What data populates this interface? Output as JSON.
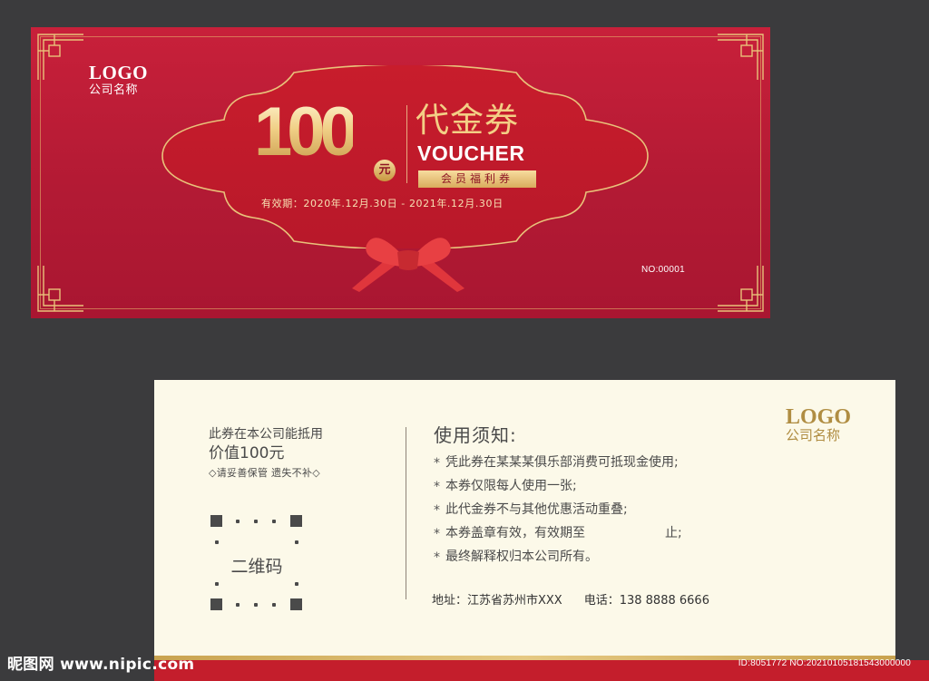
{
  "front": {
    "logo": "LOGO",
    "company": "公司名称",
    "amount": "100",
    "yuan": "元",
    "title_cn": "代金券",
    "title_en": "VOUCHER",
    "member_tag": "会员福利券",
    "validity": "有效期：2020年.12月.30日 - 2021年.12月.30日",
    "serial": "NO:00001"
  },
  "back": {
    "left": {
      "line1": "此券在本公司能抵用",
      "line2": "价值100元",
      "line3": "◇请妥善保管 遗失不补◇",
      "qr_label": "二维码"
    },
    "notice": {
      "title": "使用须知:",
      "items": [
        "凭此券在某某某俱乐部消费可抵现金使用;",
        "本券仅限每人使用一张;",
        "此代金券不与其他优惠活动重叠;"
      ],
      "item4_before": "本券盖章有效，有效期至",
      "item4_after": "止;",
      "item5": "最终解释权归本公司所有。"
    },
    "address": "地址：江苏省苏州市XXX",
    "phone": "电话：138 8888 6666",
    "logo": "LOGO",
    "company": "公司名称"
  },
  "watermark": {
    "site": "昵图网 www.nipic.com",
    "id": "ID:8051772 NO:20210105181543000000"
  },
  "colors": {
    "background": "#3b3b3d",
    "voucher_red": "#c8203a",
    "gold": "#f3cf85",
    "cream": "#fcf9e9",
    "back_logo_gold": "#b08d42"
  }
}
